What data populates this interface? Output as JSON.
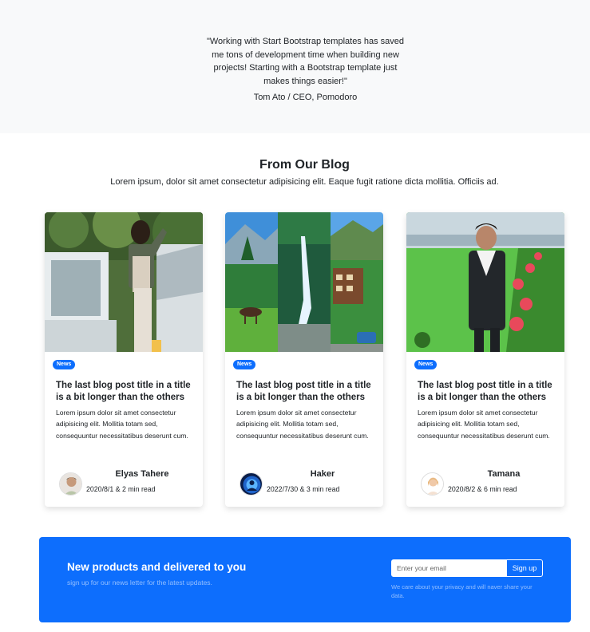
{
  "testimonial": {
    "quote": "\"Working with Start Bootstrap templates has saved me tons of development time when building new projects! Starting with a Bootstrap template just makes things easier!\"",
    "author": "Tom Ato / CEO, Pomodoro"
  },
  "blog": {
    "title": "From Our Blog",
    "subtitle": "Lorem ipsum, dolor sit amet consectetur adipisicing elit. Eaque fugit ratione dicta mollitia. Officiis ad.",
    "cards": [
      {
        "badge": "News",
        "title": "The last blog post title in a title is a bit longer than the others",
        "text": "Lorem ipsum dolor sit amet consectetur adipisicing elit. Mollitia totam sed, consequuntur necessitatibus deserunt cum.",
        "author": "Elyas Tahere",
        "meta": "2020/8/1 & 2 min read"
      },
      {
        "badge": "News",
        "title": "The last blog post title in a title is a bit longer than the others",
        "text": "Lorem ipsum dolor sit amet consectetur adipisicing elit. Mollitia totam sed, consequuntur necessitatibus deserunt cum.",
        "author": "Haker",
        "meta": "2022/7/30 & 3 min read"
      },
      {
        "badge": "News",
        "title": "The last blog post title in a title is a bit longer than the others",
        "text": "Lorem ipsum dolor sit amet consectetur adipisicing elit. Mollitia totam sed, consequuntur necessitatibus deserunt cum.",
        "author": "Tamana",
        "meta": "2020/8/2 & 6 min read"
      }
    ]
  },
  "newsletter": {
    "title": "New products and delivered to you",
    "subtitle": "sign up for our news letter for the latest updates.",
    "email_placeholder": "Enter your email",
    "button_label": "Sign up",
    "privacy_note": "We care about your privacy and will naver share your data."
  },
  "colors": {
    "primary": "#0d6efd",
    "section_bg": "#f8f9fa"
  }
}
